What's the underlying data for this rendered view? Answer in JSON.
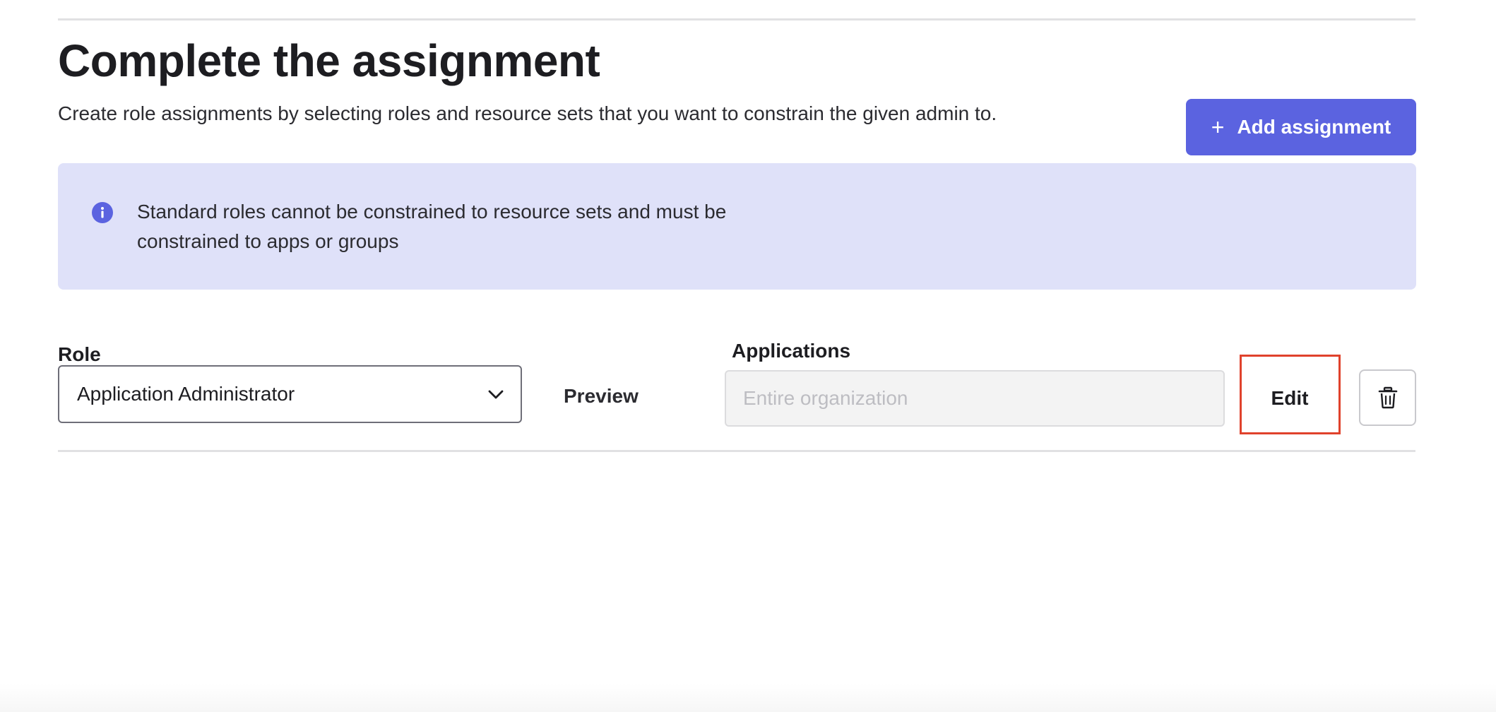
{
  "header": {
    "title": "Complete the assignment",
    "description": "Create role assignments by selecting roles and resource sets that you want to constrain the given admin to."
  },
  "toolbar": {
    "add_assignment_label": "Add assignment",
    "add_assignment_icon": "plus-icon"
  },
  "callout": {
    "icon": "info-icon",
    "line1": "Standard roles cannot be constrained to resource sets and must be",
    "line2": "constrained to apps or groups"
  },
  "assignment": {
    "role_label": "Role",
    "role_value": "Application Administrator",
    "preview_label": "Preview",
    "applications_label": "Applications",
    "applications_placeholder": "Entire organization",
    "edit_label": "Edit",
    "delete_icon": "trash-icon"
  },
  "colors": {
    "accent": "#5b63e0",
    "callout_bg": "#dfe1f9",
    "highlight": "#e0422c"
  }
}
